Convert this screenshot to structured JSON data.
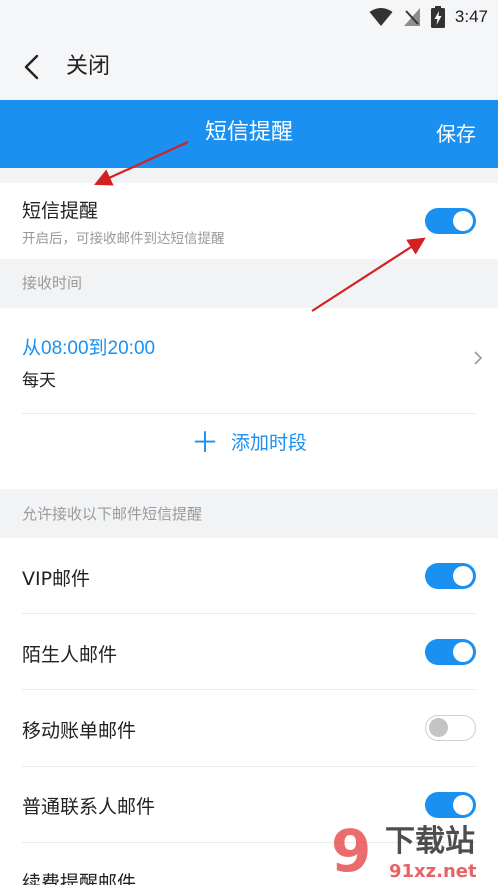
{
  "status_bar": {
    "time": "3:47",
    "icons": [
      "wifi-icon",
      "no-signal-icon",
      "battery-charging-icon"
    ]
  },
  "top_bar": {
    "close_label": "关闭"
  },
  "title_bar": {
    "title": "短信提醒",
    "save_label": "保存",
    "accent": "#1a90f0"
  },
  "sms_setting": {
    "title": "短信提醒",
    "subtitle": "开启后，可接收邮件到达短信提醒",
    "enabled": true
  },
  "receive_time": {
    "section_label": "接收时间",
    "range": "从08:00到20:00",
    "days": "每天",
    "add_label": "添加时段"
  },
  "mail_types": {
    "section_label": "允许接收以下邮件短信提醒",
    "items": [
      {
        "label": "VIP邮件",
        "enabled": true
      },
      {
        "label": "陌生人邮件",
        "enabled": true
      },
      {
        "label": "移动账单邮件",
        "enabled": false
      },
      {
        "label": "普通联系人邮件",
        "enabled": true
      },
      {
        "label": "续费提醒邮件",
        "enabled": true
      }
    ]
  },
  "watermark": {
    "logo_number": "9",
    "logo_text": "下载站",
    "site": "91xz.net"
  }
}
